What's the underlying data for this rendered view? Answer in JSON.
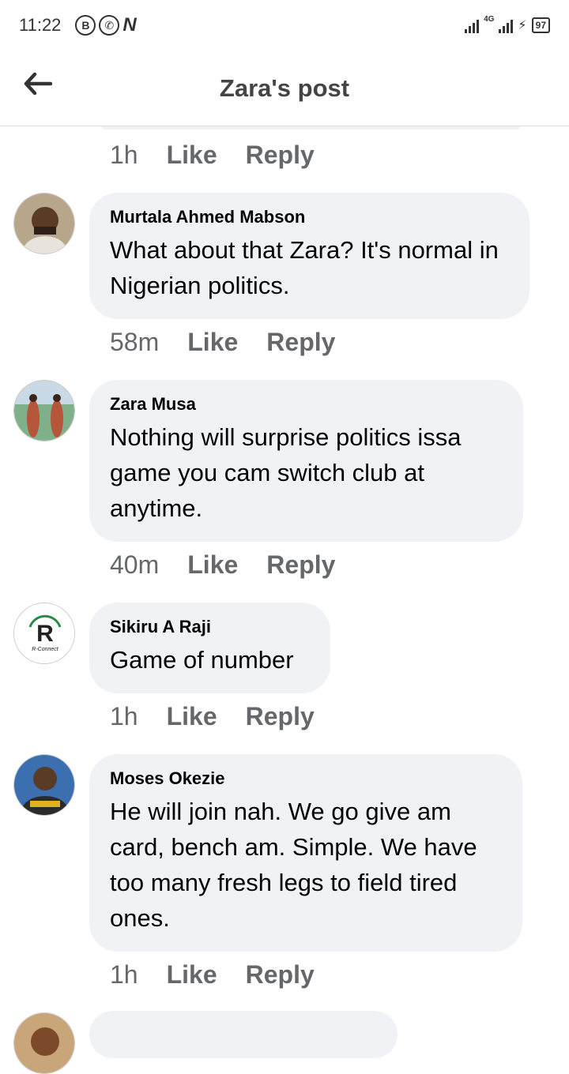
{
  "status_bar": {
    "time": "11:22",
    "left_icons": [
      "b-icon",
      "whatsapp-icon",
      "n-icon"
    ],
    "network": "4G",
    "battery": "97"
  },
  "header": {
    "title": "Zara's post"
  },
  "first_meta": {
    "time": "1h",
    "like": "Like",
    "reply": "Reply"
  },
  "comments": [
    {
      "author": "Murtala Ahmed Mabson",
      "text": "What about that Zara?  It's normal in Nigerian politics.",
      "time": "58m",
      "like": "Like",
      "reply": "Reply"
    },
    {
      "author": "Zara Musa",
      "text": "Nothing will surprise politics issa game you cam switch club at anytime.",
      "time": "40m",
      "like": "Like",
      "reply": "Reply"
    },
    {
      "author": "Sikiru A Raji",
      "text": "Game of number",
      "time": "1h",
      "like": "Like",
      "reply": "Reply"
    },
    {
      "author": "Moses Okezie",
      "text": "He will join nah. We go give am card, bench am. Simple. We have too many fresh legs to field tired ones.",
      "time": "1h",
      "like": "Like",
      "reply": "Reply"
    }
  ],
  "avatar_logo": {
    "letter": "R",
    "caption": "R-Connect"
  },
  "colors": {
    "bubble": "#f0f2f5",
    "meta": "#65676b",
    "text": "#050505"
  }
}
